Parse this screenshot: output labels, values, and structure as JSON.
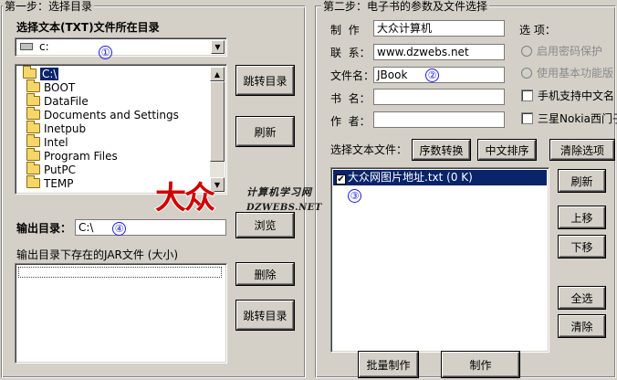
{
  "step1": {
    "title": "第一步：选择目录",
    "dir_label": "选择文本(TXT)文件所在目录",
    "drive_value": "c:",
    "tree_items": [
      "C:\\",
      "BOOT",
      "DataFile",
      "Documents and Settings",
      "Inetpub",
      "Intel",
      "Program Files",
      "PutPC",
      "TEMP"
    ],
    "jump_dir_button": "跳转目录",
    "refresh_button": "刷新",
    "output_label": "输出目录：",
    "output_value": "C:\\",
    "browse_button": "浏览",
    "jar_label": "输出目录下存在的JAR文件 (大小)",
    "delete_button": "删除",
    "jump_dir_button2": "跳转目录"
  },
  "step2": {
    "title": "第二步：电子书的参数及文件选择",
    "maker_label": "制  作",
    "maker_value": "大众计算机",
    "contact_label": "联  系：",
    "contact_value": "www.dzwebs.net",
    "filename_label": "文件名：",
    "filename_value": "JBook",
    "bookname_label": "书  名：",
    "bookname_value": "",
    "author_label": "作  者：",
    "author_value": "",
    "options_label": "选 项：",
    "opt_password": "启用密码保护",
    "opt_basic": "使用基本功能版",
    "opt_phone_cn": "手机支持中文名",
    "opt_samsung": "三星Nokia西门子",
    "select_files_label": "选择文本文件：",
    "seq_convert_button": "序数转换",
    "cn_sort_button": "中文排序",
    "clear_options_button": "清除选项",
    "file_item": "大众网图片地址.txt (0 K)",
    "refresh_button": "刷新",
    "up_button": "上移",
    "down_button": "下移",
    "select_all_button": "全选",
    "clear_button": "清除",
    "batch_make_button": "批量制作",
    "make_button": "制作"
  },
  "markers": [
    "①",
    "②",
    "③",
    "④"
  ],
  "watermark": {
    "logo_text": "大众",
    "site_cn": "计算机学习网",
    "site_en": "DZWEBS.NET"
  },
  "colors": {
    "window_bg": "#d4d0c8",
    "selection": "#0a246a",
    "marker_blue": "#1a1ae6",
    "watermark_red": "#d10000"
  }
}
